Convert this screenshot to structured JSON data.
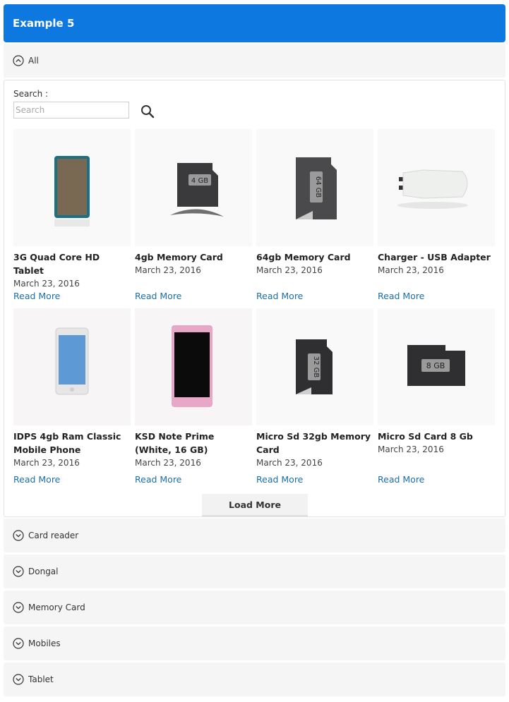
{
  "header": {
    "title": "Example 5"
  },
  "categories": [
    {
      "label": "All"
    },
    {
      "label": "Card reader"
    },
    {
      "label": "Dongal"
    },
    {
      "label": "Memory Card"
    },
    {
      "label": "Mobiles"
    },
    {
      "label": "Tablet"
    }
  ],
  "search": {
    "label": "Search :",
    "placeholder": "Search"
  },
  "products": [
    {
      "title": "3G Quad Core HD Tablet",
      "date": "March 23, 2016",
      "more": "Read More"
    },
    {
      "title": "4gb Memory Card",
      "date": "March 23, 2016",
      "more": "Read More"
    },
    {
      "title": "64gb Memory Card",
      "date": "March 23, 2016",
      "more": "Read More"
    },
    {
      "title": "Charger - USB Adapter",
      "date": "March 23, 2016",
      "more": "Read More"
    },
    {
      "title": "IDPS 4gb Ram Classic Mobile Phone",
      "date": "March 23, 2016",
      "more": "Read More"
    },
    {
      "title": "KSD Note Prime (White, 16 GB)",
      "date": "March 23, 2016",
      "more": "Read More"
    },
    {
      "title": "Micro Sd 32gb Memory Card",
      "date": "March 23, 2016",
      "more": "Read More"
    },
    {
      "title": "Micro Sd Card 8 Gb",
      "date": "March 23, 2016",
      "more": "Read More"
    }
  ],
  "card_labels": {
    "sd4": "4 GB",
    "sd64": "64 GB",
    "sd32": "32 GB",
    "sd8": "8 GB"
  },
  "load_more": "Load More",
  "colors": {
    "accent": "#0d78e0",
    "link": "#1a6fa8",
    "accordion_bg": "#f5f5f5"
  }
}
